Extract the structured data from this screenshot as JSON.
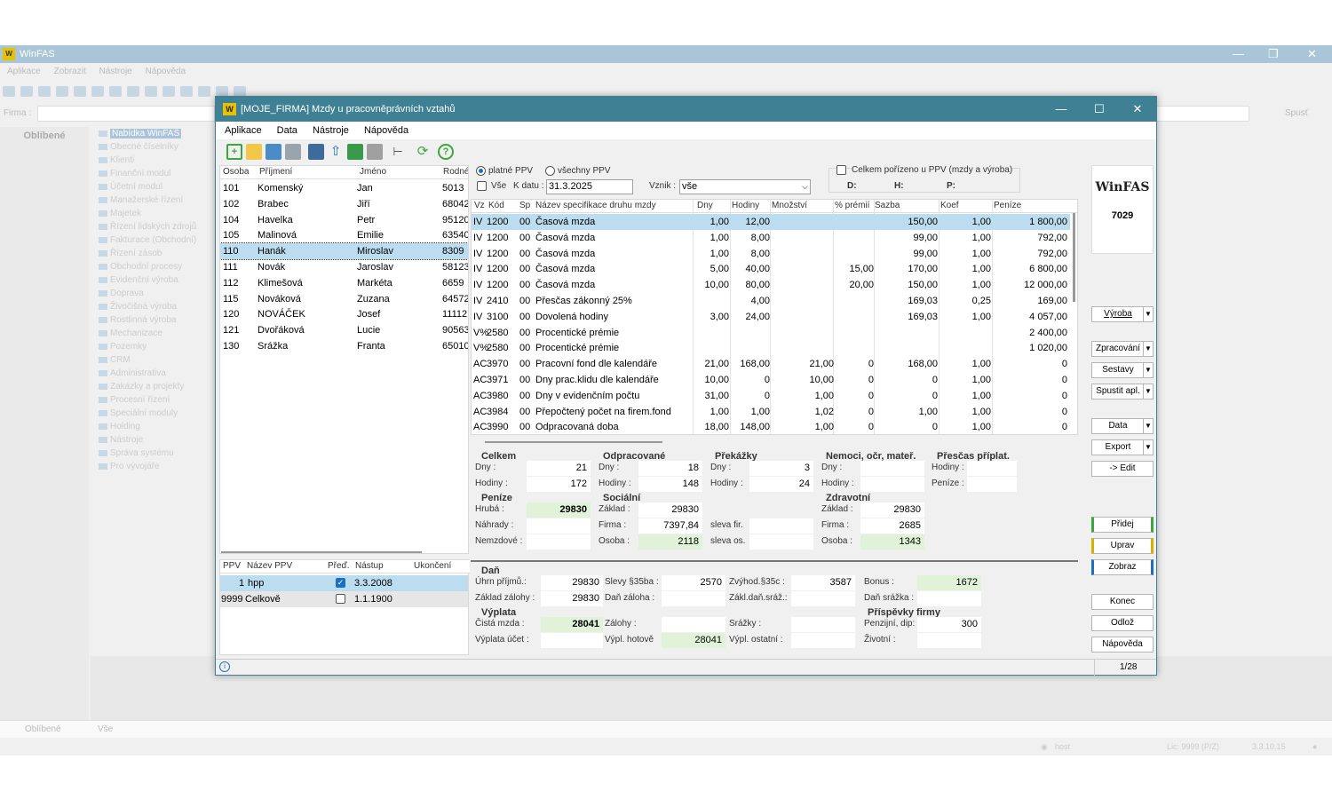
{
  "bg": {
    "title": "WinFAS",
    "menu": [
      "Aplikace",
      "Zobrazit",
      "Nástroje",
      "Nápověda"
    ],
    "firma_label": "Firma :",
    "spust": "Spusť",
    "favorites": "Oblíbené",
    "tree_root": "Nabídka WinFAS",
    "tree": [
      "Obecné číselníky",
      "Klienti",
      "Finanční modul",
      "Účetní modul",
      "Manažerské řízení",
      "Majetek",
      "Řízení lidských zdrojů",
      "Fakturace (Obchodní)",
      "Řízení zásob",
      "Obchodní procesy",
      "Evidenční výroba",
      "Doprava",
      "Živočišná výroba",
      "Rostlinná výroba",
      "Mechanizace",
      "Pozemky",
      "CRM",
      "Administrativa",
      "Zakázky a projekty",
      "Procesní řízení",
      "Speciální moduly",
      "Holding",
      "Nástroje",
      "Správa systému",
      "Pro vývojáře"
    ],
    "bottom_fav": "Oblíbené",
    "bottom_all": "Vše",
    "status_user": "host",
    "status_lic": "Lic: 9999 (P/Z)",
    "status_ver": "3.3.10.15"
  },
  "dialog": {
    "title": "[MOJE_FIRMA] Mzdy u pracovněprávních vztahů",
    "menu": [
      "Aplikace",
      "Data",
      "Nástroje",
      "Nápověda"
    ]
  },
  "persons": {
    "headers": [
      "Osoba",
      "Příjmení",
      "Jméno",
      "Rodné"
    ],
    "rows": [
      [
        "101",
        "Komenský",
        "Jan",
        "5013"
      ],
      [
        "102",
        "Brabec",
        "Jiří",
        "68042"
      ],
      [
        "104",
        "Havelka",
        "Petr",
        "95120"
      ],
      [
        "105",
        "Malinová",
        "Emilie",
        "63540"
      ],
      [
        "110",
        "Hanák",
        "Miroslav",
        "8309"
      ],
      [
        "111",
        "Novák",
        "Jaroslav",
        "58123"
      ],
      [
        "112",
        "Klimešová",
        "Markéta",
        "6659"
      ],
      [
        "115",
        "Nováková",
        "Zuzana",
        "64572"
      ],
      [
        "120",
        "NOVÁČEK",
        "Josef",
        "11112"
      ],
      [
        "121",
        "Dvořáková",
        "Lucie",
        "90563"
      ],
      [
        "130",
        "Srážka",
        "Franta",
        "65010"
      ]
    ],
    "selected": 4
  },
  "ppv": {
    "headers": [
      "PPV",
      "Název PPV",
      "Přeď.",
      "Nástup",
      "Ukončení"
    ],
    "rows": [
      {
        "ppv": "1",
        "name": "hpp",
        "checked": true,
        "start": "3.3.2008",
        "end": ""
      },
      {
        "ppv": "9999",
        "name": "Celkově",
        "checked": false,
        "start": "1.1.1900",
        "end": ""
      }
    ]
  },
  "filters": {
    "radio1": "platné PPV",
    "radio2": "všechny PPV",
    "vse": "Vše",
    "kdatu_label": "K datu :",
    "kdatu_value": "31.3.2025",
    "vznik_label": "Vznik :",
    "vznik_value": "vše",
    "celkem_label": "Celkem pořízeno u PPV (mzdy a výroba)",
    "d_label": "D:",
    "h_label": "H:",
    "p_label": "P:"
  },
  "wages": {
    "headers": [
      "Vz",
      "Kód",
      "Sp",
      "Název specifikace druhu mzdy",
      "Dny",
      "Hodiny",
      "Množství",
      "% prémií",
      "Sazba",
      "Koef",
      "Peníze"
    ],
    "rows": [
      [
        "IV",
        "1200",
        "00",
        "Časová mzda",
        "1,00",
        "12,00",
        "",
        "",
        "150,00",
        "1,00",
        "1 800,00"
      ],
      [
        "IV",
        "1200",
        "00",
        "Časová mzda",
        "1,00",
        "8,00",
        "",
        "",
        "99,00",
        "1,00",
        "792,00"
      ],
      [
        "IV",
        "1200",
        "00",
        "Časová mzda",
        "1,00",
        "8,00",
        "",
        "",
        "99,00",
        "1,00",
        "792,00"
      ],
      [
        "IV",
        "1200",
        "00",
        "Časová mzda",
        "5,00",
        "40,00",
        "",
        "15,00",
        "170,00",
        "1,00",
        "6 800,00"
      ],
      [
        "IV",
        "1200",
        "00",
        "Časová mzda",
        "10,00",
        "80,00",
        "",
        "20,00",
        "150,00",
        "1,00",
        "12 000,00"
      ],
      [
        "IV",
        "2410",
        "00",
        "Přesčas zákonný 25%",
        "",
        "4,00",
        "",
        "",
        "169,03",
        "0,25",
        "169,00"
      ],
      [
        "IV",
        "3100",
        "00",
        "Dovolená hodiny",
        "3,00",
        "24,00",
        "",
        "",
        "169,03",
        "1,00",
        "4 057,00"
      ],
      [
        "V%",
        "2580",
        "00",
        "Procentické prémie",
        "",
        "",
        "",
        "",
        "",
        "",
        "2 400,00"
      ],
      [
        "V%",
        "2580",
        "00",
        "Procentické prémie",
        "",
        "",
        "",
        "",
        "",
        "",
        "1 020,00"
      ],
      [
        "AC",
        "3970",
        "00",
        "Pracovní fond dle kalendáře",
        "21,00",
        "168,00",
        "21,00",
        "0",
        "168,00",
        "1,00",
        "0"
      ],
      [
        "AC",
        "3971",
        "00",
        "Dny prac.klidu dle kalendáře",
        "10,00",
        "0",
        "10,00",
        "0",
        "0",
        "1,00",
        "0"
      ],
      [
        "AC",
        "3980",
        "00",
        "Dny v evidenčním počtu",
        "31,00",
        "0",
        "1,00",
        "0",
        "0",
        "1,00",
        "0"
      ],
      [
        "AC",
        "3984",
        "00",
        "Přepočtený počet na firem.fond",
        "1,00",
        "1,00",
        "1,02",
        "0",
        "1,00",
        "1,00",
        "0"
      ],
      [
        "AC",
        "3990",
        "00",
        "Odpracovaná doba",
        "18,00",
        "148,00",
        "1,00",
        "0",
        "0",
        "1,00",
        "0"
      ]
    ]
  },
  "summary": {
    "celkem": {
      "title": "Celkem",
      "dny_l": "Dny :",
      "dny": "21",
      "hod_l": "Hodiny :",
      "hod": "172"
    },
    "odprac": {
      "title": "Odpracované",
      "dny_l": "Dny :",
      "dny": "18",
      "hod_l": "Hodiny :",
      "hod": "148"
    },
    "prekazky": {
      "title": "Překážky",
      "dny_l": "Dny :",
      "dny": "3",
      "hod_l": "Hodiny :",
      "hod": "24"
    },
    "nemoci": {
      "title": "Nemoci, očr, mateř.",
      "dny_l": "Dny :",
      "dny": "",
      "hod_l": "Hodiny :",
      "hod": ""
    },
    "prescas": {
      "title": "Přesčas příplat.",
      "hod_l": "Hodiny :",
      "hod": "",
      "pen_l": "Peníze :",
      "pen": ""
    },
    "penize": {
      "title": "Peníze",
      "hruba_l": "Hrubá :",
      "hruba": "29830",
      "nahrady_l": "Náhrady :",
      "nahrady": "",
      "nemzd_l": "Nemzdové :",
      "nemzd": ""
    },
    "socialni": {
      "title": "Sociální",
      "zaklad_l": "Základ :",
      "zaklad": "29830",
      "firma_l": "Firma :",
      "firma": "7397,84",
      "osoba_l": "Osoba :",
      "osoba": "2118",
      "slevafir_l": "sleva fir.",
      "slevafir": "",
      "slevaos_l": "sleva os.",
      "slevaos": ""
    },
    "zdrav": {
      "title": "Zdravotní",
      "zaklad_l": "Základ :",
      "zaklad": "29830",
      "firma_l": "Firma :",
      "firma": "2685",
      "osoba_l": "Osoba :",
      "osoba": "1343"
    },
    "dan": {
      "title": "Daň",
      "uhrn_l": "Úhrn příjmů.:",
      "uhrn": "29830",
      "slevy_l": "Slevy §35ba :",
      "slevy": "2570",
      "zvyh_l": "Zvýhod.§35c :",
      "zvyh": "3587",
      "bonus_l": "Bonus :",
      "bonus": "1672",
      "zakzal_l": "Základ zálohy :",
      "zakzal": "29830",
      "danzal_l": "Daň záloha :",
      "danzal": "",
      "zakdansraz_l": "Zákl.daň.sráž.:",
      "zakdansraz": "",
      "dansrazka_l": "Daň srážka :",
      "dansrazka": ""
    },
    "vyplata": {
      "title": "Výplata",
      "cista_l": "Čistá mzda :",
      "cista": "28041",
      "zalohy_l": "Zálohy :",
      "zalohy": "",
      "srazky_l": "Srážky :",
      "srazky": "",
      "ucet_l": "Výplata účet :",
      "ucet": "",
      "hotove_l": "Výpl. hotově",
      "hotove": "28041",
      "ostatni_l": "Výpl. ostatní :",
      "ostatni": ""
    },
    "prispevky": {
      "title": "Příspěvky firmy",
      "penz_l": "Penzijní, dip:",
      "penz": "300",
      "zivot_l": "Životní :",
      "zivot": ""
    }
  },
  "side": {
    "logo": "WinFAS",
    "number": "7029",
    "vyroba": "Výroba",
    "zpracovani": "Zpracování",
    "sestavy": "Sestavy",
    "spustit": "Spustit apl.",
    "data": "Data",
    "export": "Export",
    "edit": "-> Edit",
    "pridej": "Přidej",
    "uprav": "Uprav",
    "zobraz": "Zobraz",
    "konec": "Konec",
    "odloz": "Odlož",
    "napoveda": "Nápověda"
  },
  "status": {
    "info": "i",
    "page": "1/28"
  },
  "colors": {
    "title_bar": "#3f8095",
    "selection": "#bcdcf0",
    "green_value": "#e0f3d8",
    "pridej": "#3da63d",
    "uprav": "#d4b000",
    "zobraz": "#1d6fc1"
  }
}
